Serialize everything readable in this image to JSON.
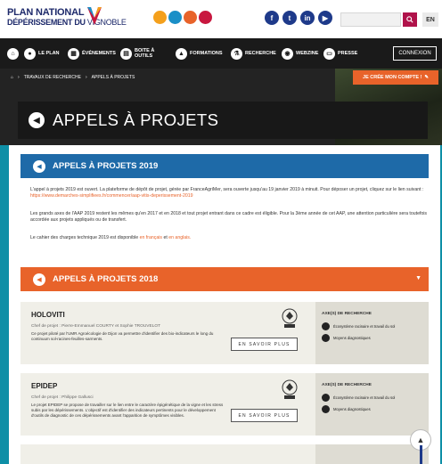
{
  "header": {
    "logo_line1": "PLAN NATIONAL",
    "logo_line2a": "DÉPÉRISSEMENT DU",
    "logo_line2b": "VIGNOBLE",
    "partner_colors": [
      "#f4a01c",
      "#1a8fc7",
      "#e8632a",
      "#c8173f"
    ],
    "social": [
      {
        "icon": "facebook-icon",
        "glyph": "f"
      },
      {
        "icon": "twitter-icon",
        "glyph": "t"
      },
      {
        "icon": "linkedin-icon",
        "glyph": "in"
      },
      {
        "icon": "youtube-icon",
        "glyph": "▶"
      }
    ],
    "search_placeholder": "",
    "lang": "EN"
  },
  "nav": {
    "items": [
      {
        "label": "LE PLAN",
        "icon": "plan-icon"
      },
      {
        "label": "ÉVÉNEMENTS",
        "icon": "calendar-icon"
      },
      {
        "label": "BOITE À OUTILS",
        "icon": "toolbox-icon"
      },
      {
        "label": "FORMATIONS",
        "icon": "graduation-icon"
      },
      {
        "label": "RECHERCHE",
        "icon": "flask-icon"
      },
      {
        "label": "WEBZINE",
        "icon": "webzine-icon"
      },
      {
        "label": "PRESSE",
        "icon": "press-icon"
      }
    ],
    "login": "CONNEXION"
  },
  "hero": {
    "breadcrumb": [
      "TRAVAUX DE RECHERCHE",
      "APPELS À PROJETS"
    ],
    "cta": "JE CRÉE MON COMPTE !",
    "title": "APPELS À PROJETS"
  },
  "section2019": {
    "title": "APPELS À PROJETS 2019",
    "color": "#1e6aa8",
    "p1": "L'appel à projets 2019 est ouvert. La plateforme de dépôt de projet, gérée par FranceAgriMer, sera ouverte jusqu'au 19 janvier 2019 à minuit. Pour déposer un projet, cliquez sur le lien suivant :",
    "p1_link": "https://www.demarches-simplifiees.fr/commencer/aap-vitis-deperissement-2019",
    "p2": "Les grands axes de l'AAP 2019 restent les mêmes qu'en 2017 et en 2018 et tout projet entrant dans ce cadre est éligible. Pour la 3ème année de cet AAP, une attention particulière sera toutefois accordée aux projets appliqués ou de transfert.",
    "p3_pre": "Le cahier des charges technique 2019 est disponible",
    "p3_link1": "en français",
    "p3_mid": "et",
    "p3_link2": "en anglais."
  },
  "section2018": {
    "title": "APPELS À PROJETS 2018",
    "color": "#e8632a"
  },
  "projects": [
    {
      "name": "HOLOVITI",
      "chef": "Chef de projet : Pierre-Emmanuel COURTY et Sophie TROUVELOT",
      "desc": "Ce projet piloté par l'UMR Agroécologie de Dijon va permettre d'identifier des bio-indicateurs le long du continuum sol-racines-feuilles-sarments.",
      "more": "EN SAVOIR PLUS",
      "axes_title": "AXE(S) DE RECHERCHE",
      "axes": [
        "Écosystème racinaire et travail du sol",
        "Moyens diagnostiques"
      ]
    },
    {
      "name": "EPIDEP",
      "chef": "Chef de projet : Philippe Gallusci",
      "desc": "Le projet EPIDEP se propose de travailler sur le lien entre le caractère épigénétique de la vigne et les stress subis par les dépérissements. L'objectif est d'identifier des indicateurs pertinents pour le développement d'outils de diagnostic de ces dépérissements avant l'apparition de symptômes visibles.",
      "more": "EN SAVOIR PLUS",
      "axes_title": "AXE(S) DE RECHERCHE",
      "axes": [
        "Écosystème racinaire et travail du sol",
        "Moyens diagnostiques"
      ]
    }
  ]
}
